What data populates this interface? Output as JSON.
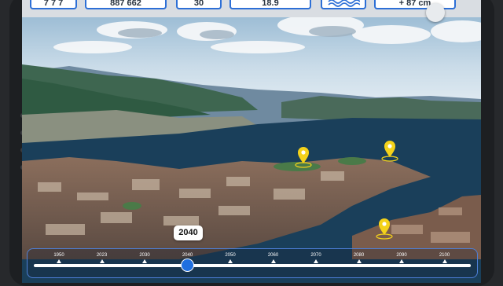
{
  "top_stats": {
    "stat_1": "7 7 7",
    "stat_2": "887 662",
    "stat_3": "30",
    "stat_4": "18.9",
    "stat_5_icon": "sea-waves-icon",
    "stat_6": "+ 87 cm"
  },
  "timeline": {
    "selected_year_label": "2040",
    "selected_year": 2040,
    "years": [
      "1950",
      "2023",
      "2030",
      "2040",
      "2050",
      "2060",
      "2070",
      "2080",
      "2090",
      "2100"
    ]
  },
  "colors": {
    "accent": "#2d6fd6",
    "thumb": "#1f6fe0",
    "pin": "#f4d21a",
    "water": "#1a3f5a"
  }
}
